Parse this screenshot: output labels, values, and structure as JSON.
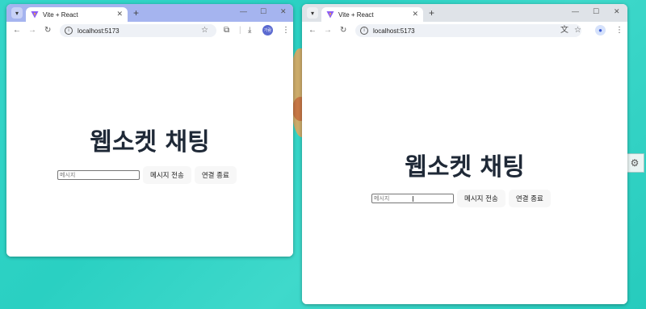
{
  "windows": [
    {
      "tab_title": "Vite + React",
      "url": "localhost:5173",
      "profile_initial": "가람",
      "heading": "웹소켓 채팅",
      "input_placeholder": "메시지",
      "send_label": "메시지 전송",
      "disconnect_label": "연결 종료",
      "chrome_color": "#a5b4ef"
    },
    {
      "tab_title": "Vite + React",
      "url": "localhost:5173",
      "heading": "웹소켓 채팅",
      "input_placeholder": "메시지",
      "send_label": "메시지 전송",
      "disconnect_label": "연결 종료",
      "chrome_color": "#dfe3e8"
    }
  ],
  "icons": {
    "tab_menu": "chevron-down-icon",
    "back": "arrow-left-icon",
    "forward": "arrow-right-icon",
    "reload": "reload-icon",
    "bookmark": "star-icon",
    "extensions": "puzzle-icon",
    "download": "download-icon",
    "translate": "translate-icon",
    "profile": "profile-icon",
    "menu": "kebab-menu-icon"
  }
}
